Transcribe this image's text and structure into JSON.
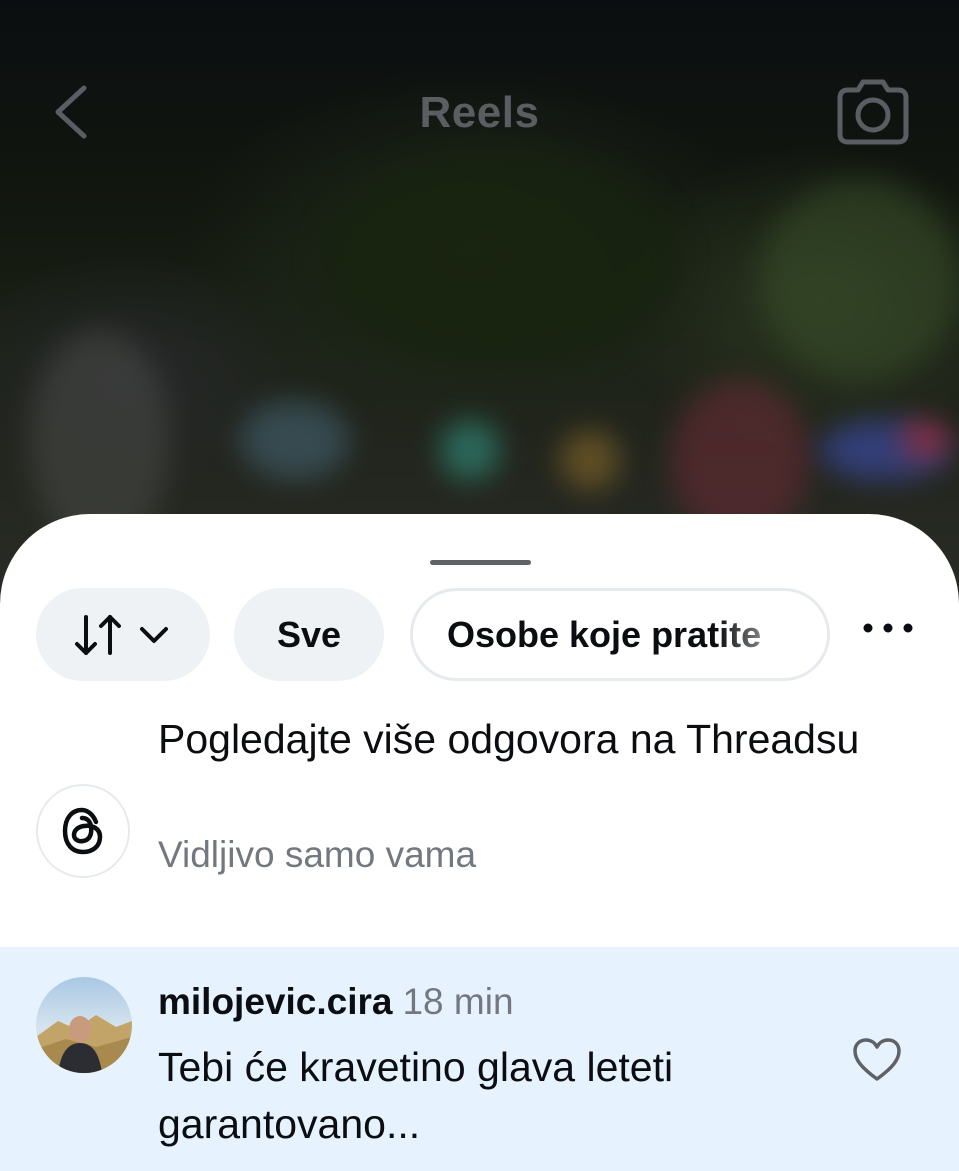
{
  "header": {
    "title": "Reels",
    "back_icon": "chevron-left-icon",
    "camera_icon": "camera-icon"
  },
  "sheet": {
    "filters": {
      "sort_icon": "sort-arrows-icon",
      "all_label": "Sve",
      "following_label": "Osobe koje pratite",
      "more_icon": "more-horizontal-icon"
    },
    "threads_promo": {
      "icon": "threads-logo-icon",
      "title": "Pogledajte više odgovora na Threadsu",
      "subtitle": "Vidljivo samo vama"
    },
    "comment": {
      "username": "milojevic.cira",
      "time": "18 min",
      "text": "Tebi će kravetino glava leteti garantovano...",
      "like_icon": "heart-icon"
    }
  },
  "colors": {
    "sheet_bg": "#ffffff",
    "chip_bg": "#eff2f5",
    "comment_highlight": "#e6f3ff",
    "secondary_text": "#737880"
  }
}
